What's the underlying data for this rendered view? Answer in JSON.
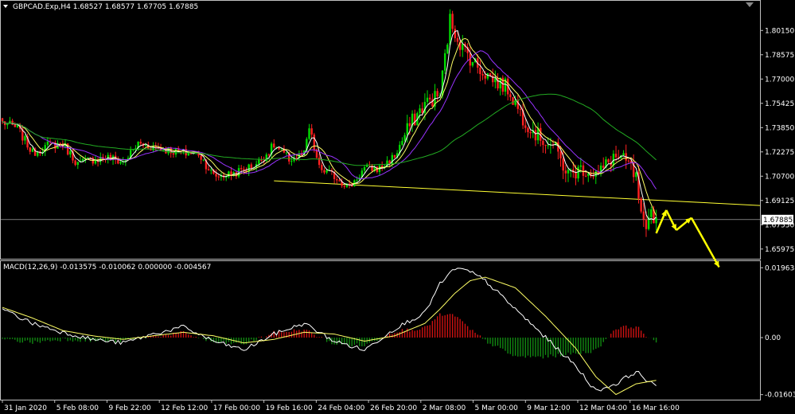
{
  "window": {
    "title": "GBPCAD.Exp,H4  1.68527 1.68577 1.67705 1.67885",
    "menu_icon": "triangle-down-icon",
    "corner_icon": "triangle-icon"
  },
  "colors": {
    "background": "#000000",
    "bull_candle": "#00dd00",
    "bear_candle": "#ff2020",
    "ma_fast": "#ffffff",
    "ma_mid": "#ffff66",
    "ma_slow": "#9933ff",
    "ma_long": "#22aa22",
    "trendline": "#ffff33",
    "arrow": "#ffff00",
    "macd_line": "#ffffff",
    "signal_line": "#ffff66",
    "hist_pos": "#cc1111",
    "hist_neg": "#118811",
    "frame": "#c0c0c0"
  },
  "chart_data": [
    {
      "type": "candlestick",
      "title": "GBPCAD.Exp,H4  1.68527 1.68577 1.67705 1.67885",
      "price_axis_labels": [
        "1.80150",
        "1.78575",
        "1.77000",
        "1.75425",
        "1.73850",
        "1.72275",
        "1.70700",
        "1.69125",
        "1.67550",
        "1.65975"
      ],
      "current_price": "1.67885",
      "ylim": [
        1.655,
        1.813
      ],
      "anchors": [
        [
          0,
          1.742
        ],
        [
          6,
          1.738
        ],
        [
          12,
          1.722
        ],
        [
          18,
          1.727
        ],
        [
          24,
          1.728
        ],
        [
          30,
          1.715
        ],
        [
          36,
          1.718
        ],
        [
          42,
          1.719
        ],
        [
          48,
          1.716
        ],
        [
          54,
          1.728
        ],
        [
          60,
          1.726
        ],
        [
          66,
          1.724
        ],
        [
          72,
          1.722
        ],
        [
          78,
          1.722
        ],
        [
          84,
          1.707
        ],
        [
          90,
          1.708
        ],
        [
          96,
          1.711
        ],
        [
          102,
          1.716
        ],
        [
          108,
          1.727
        ],
        [
          114,
          1.718
        ],
        [
          120,
          1.721
        ],
        [
          122,
          1.738
        ],
        [
          126,
          1.712
        ],
        [
          132,
          1.707
        ],
        [
          138,
          1.7
        ],
        [
          144,
          1.712
        ],
        [
          150,
          1.712
        ],
        [
          156,
          1.72
        ],
        [
          162,
          1.74
        ],
        [
          168,
          1.754
        ],
        [
          174,
          1.76
        ],
        [
          178,
          1.808
        ],
        [
          183,
          1.79
        ],
        [
          189,
          1.778
        ],
        [
          195,
          1.77
        ],
        [
          201,
          1.764
        ],
        [
          207,
          1.745
        ],
        [
          213,
          1.733
        ],
        [
          219,
          1.727
        ],
        [
          225,
          1.708
        ],
        [
          231,
          1.712
        ],
        [
          237,
          1.708
        ],
        [
          243,
          1.72
        ],
        [
          249,
          1.715
        ],
        [
          252,
          1.705
        ],
        [
          254,
          1.68
        ],
        [
          256,
          1.668
        ],
        [
          258,
          1.685
        ],
        [
          260,
          1.678
        ]
      ],
      "annotation_arrow": [
        [
          1.67,
          1.685
        ],
        [
          1.685,
          1.672
        ],
        [
          1.672,
          1.68
        ],
        [
          1.68,
          1.648
        ]
      ],
      "trendline": {
        "from": [
          1.704
        ],
        "to": [
          1.688
        ]
      }
    },
    {
      "type": "line",
      "title": "MACD(12,26,9) -0.013575 -0.010062 0.000000 -0.004567",
      "axis_labels": [
        "0.019638",
        "0.00",
        "-0.016033"
      ],
      "ylim": [
        -0.017,
        0.0206
      ],
      "x_tick_labels": [
        "31 Jan 2020",
        "5 Feb 08:00",
        "9 Feb 22:00",
        "12 Feb 12:00",
        "17 Feb 00:00",
        "19 Feb 16:00",
        "24 Feb 04:00",
        "26 Feb 20:00",
        "2 Mar 08:00",
        "5 Mar 00:00",
        "9 Mar 12:00",
        "12 Mar 04:00",
        "16 Mar 16:00"
      ],
      "macd_anchors": [
        [
          0,
          0.008
        ],
        [
          12,
          0.004
        ],
        [
          24,
          0.0015
        ],
        [
          36,
          -0.0005
        ],
        [
          48,
          -0.0015
        ],
        [
          60,
          0.001
        ],
        [
          72,
          0.003
        ],
        [
          84,
          -0.001
        ],
        [
          96,
          -0.0035
        ],
        [
          108,
          0.001
        ],
        [
          120,
          0.004
        ],
        [
          132,
          -0.001
        ],
        [
          144,
          -0.0035
        ],
        [
          156,
          0.0025
        ],
        [
          168,
          0.007
        ],
        [
          174,
          0.015
        ],
        [
          180,
          0.0195
        ],
        [
          186,
          0.0185
        ],
        [
          192,
          0.016
        ],
        [
          204,
          0.008
        ],
        [
          216,
          0.0
        ],
        [
          228,
          -0.008
        ],
        [
          236,
          -0.015
        ],
        [
          244,
          -0.013
        ],
        [
          252,
          -0.0095
        ],
        [
          260,
          -0.014
        ]
      ],
      "signal_anchors": [
        [
          0,
          0.0085
        ],
        [
          12,
          0.0055
        ],
        [
          24,
          0.002
        ],
        [
          36,
          0.0005
        ],
        [
          48,
          -0.0005
        ],
        [
          60,
          0.0005
        ],
        [
          72,
          0.0015
        ],
        [
          84,
          0.0005
        ],
        [
          96,
          -0.0015
        ],
        [
          108,
          -0.0005
        ],
        [
          120,
          0.0015
        ],
        [
          132,
          0.001
        ],
        [
          144,
          -0.001
        ],
        [
          156,
          0.0005
        ],
        [
          168,
          0.004
        ],
        [
          174,
          0.008
        ],
        [
          180,
          0.0125
        ],
        [
          186,
          0.016
        ],
        [
          192,
          0.017
        ],
        [
          204,
          0.014
        ],
        [
          216,
          0.006
        ],
        [
          228,
          -0.003
        ],
        [
          236,
          -0.011
        ],
        [
          244,
          -0.016
        ],
        [
          252,
          -0.013
        ],
        [
          260,
          -0.012
        ]
      ]
    }
  ]
}
